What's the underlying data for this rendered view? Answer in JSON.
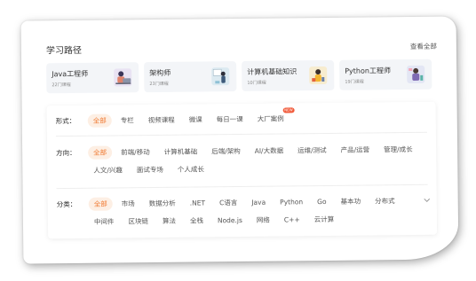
{
  "header": {
    "title": "学习路径",
    "view_all": "查看全部"
  },
  "paths": [
    {
      "name": "Java工程师",
      "count": "22门课程",
      "icon": "developer-laptop-icon"
    },
    {
      "name": "架构师",
      "count": "23门课程",
      "icon": "architect-whiteboard-icon"
    },
    {
      "name": "计算机基础知识",
      "count": "10门课程",
      "icon": "computer-basics-icon"
    },
    {
      "name": "Python工程师",
      "count": "19门课程",
      "icon": "python-developer-icon"
    }
  ],
  "filters": {
    "form": {
      "label": "形式：",
      "items": [
        "全部",
        "专栏",
        "视频课程",
        "微课",
        "每日一课",
        "大厂案例"
      ],
      "badge": "NEW"
    },
    "direction": {
      "label": "方向：",
      "items": [
        "全部",
        "前端/移动",
        "计算机基础",
        "后端/架构",
        "AI/大数据",
        "运维/测试",
        "产品/运营",
        "管理/成长",
        "人文/兴趣",
        "面试专场",
        "个人成长"
      ]
    },
    "category": {
      "label": "分类：",
      "items": [
        "全部",
        "市场",
        "数据分析",
        ".NET",
        "C语言",
        "Java",
        "Python",
        "Go",
        "基本功",
        "分布式",
        "中间件",
        "区块链",
        "算法",
        "全栈",
        "Node.js",
        "网络",
        "C++",
        "云计算"
      ]
    }
  },
  "colors": {
    "accent": "#f07a32",
    "active_bg": "#fdefe4",
    "card_bg": "#f3f5f8"
  }
}
